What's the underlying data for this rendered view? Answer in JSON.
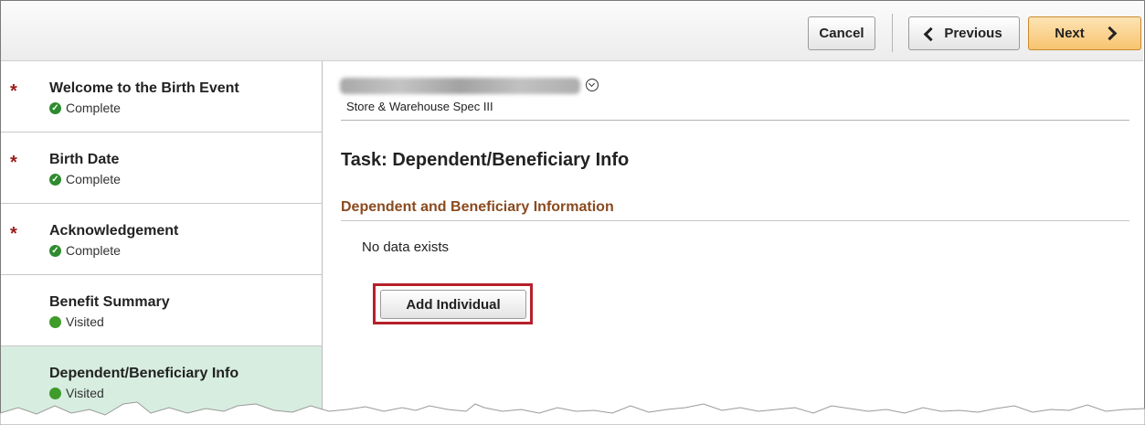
{
  "toolbar": {
    "cancel_label": "Cancel",
    "previous_label": "Previous",
    "next_label": "Next"
  },
  "sidebar": {
    "steps": [
      {
        "label": "Welcome to the Birth Event",
        "status": "Complete",
        "required": true
      },
      {
        "label": "Birth Date",
        "status": "Complete",
        "required": true
      },
      {
        "label": "Acknowledgement",
        "status": "Complete",
        "required": true
      },
      {
        "label": "Benefit Summary",
        "status": "Visited",
        "required": false
      },
      {
        "label": "Dependent/Beneficiary Info",
        "status": "Visited",
        "required": false,
        "active": true
      }
    ],
    "required_marker": "*"
  },
  "main": {
    "job_title": "Store & Warehouse Spec III",
    "task_title": "Task: Dependent/Beneficiary Info",
    "section_title": "Dependent and Beneficiary Information",
    "no_data_text": "No data exists",
    "add_button_label": "Add Individual"
  },
  "colors": {
    "required_star": "#9b1b1b",
    "status_green": "#2e8b2e",
    "active_step_bg": "#d7ede0",
    "section_title": "#8a4a1f",
    "highlight_outline": "#b5202b",
    "next_button": "#f7c46f"
  }
}
